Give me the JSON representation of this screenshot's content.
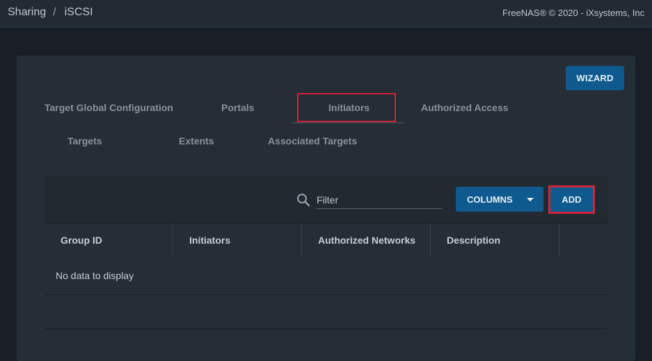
{
  "header": {
    "breadcrumb": [
      "Sharing",
      "iSCSI"
    ],
    "breadcrumb_separator": "/",
    "copyright": "FreeNAS® © 2020 - iXsystems, Inc"
  },
  "wizard_button": {
    "label": "WIZARD"
  },
  "tabs": {
    "row1": [
      {
        "label": "Target Global Configuration",
        "active": false
      },
      {
        "label": "Portals",
        "active": false
      },
      {
        "label": "Initiators",
        "active": true
      },
      {
        "label": "Authorized Access",
        "active": false
      }
    ],
    "row2": [
      {
        "label": "Targets",
        "active": false
      },
      {
        "label": "Extents",
        "active": false
      },
      {
        "label": "Associated Targets",
        "active": false
      }
    ]
  },
  "toolbar": {
    "search_icon": "search-icon",
    "filter_placeholder": "Filter",
    "filter_value": "",
    "columns_label": "COLUMNS",
    "add_label": "ADD"
  },
  "table": {
    "columns": [
      "Group ID",
      "Initiators",
      "Authorized Networks",
      "Description"
    ],
    "rows": [],
    "empty_message": "No data to display"
  },
  "colors": {
    "accent": "#0e5a8f",
    "highlight": "#d0243a",
    "card_bg": "#252d36",
    "page_bg": "#1a1f27"
  }
}
